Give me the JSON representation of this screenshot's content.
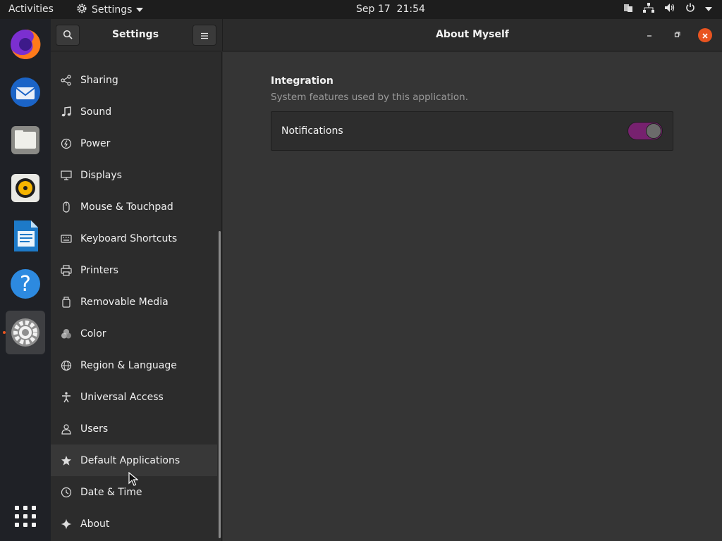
{
  "topbar": {
    "activities": "Activities",
    "app_menu": "Settings",
    "clock": "Sep 17  21:54"
  },
  "dock": {
    "items": [
      "firefox-icon",
      "thunderbird-icon",
      "files-icon",
      "rhythmbox-icon",
      "libreoffice-writer-icon",
      "help-icon",
      "settings-icon",
      "show-apps-icon"
    ]
  },
  "header": {
    "sidebar_title": "Settings",
    "page_title": "About Myself"
  },
  "sidebar": {
    "items": [
      {
        "label": "Sharing",
        "icon": "share-icon"
      },
      {
        "label": "Sound",
        "icon": "music-note-icon"
      },
      {
        "label": "Power",
        "icon": "power-icon"
      },
      {
        "label": "Displays",
        "icon": "display-icon"
      },
      {
        "label": "Mouse & Touchpad",
        "icon": "mouse-icon"
      },
      {
        "label": "Keyboard Shortcuts",
        "icon": "keyboard-icon"
      },
      {
        "label": "Printers",
        "icon": "printer-icon"
      },
      {
        "label": "Removable Media",
        "icon": "removable-media-icon"
      },
      {
        "label": "Color",
        "icon": "color-icon"
      },
      {
        "label": "Region & Language",
        "icon": "globe-icon"
      },
      {
        "label": "Universal Access",
        "icon": "accessibility-icon"
      },
      {
        "label": "Users",
        "icon": "users-icon"
      },
      {
        "label": "Default Applications",
        "icon": "star-icon"
      },
      {
        "label": "Date & Time",
        "icon": "clock-icon"
      },
      {
        "label": "About",
        "icon": "sparkle-icon"
      }
    ]
  },
  "content": {
    "section_title": "Integration",
    "section_subtitle": "System features used by this application.",
    "notifications_label": "Notifications",
    "notifications_enabled": true
  },
  "colors": {
    "accent": "#e95420",
    "switch_on": "#77216f",
    "dock_bg": "#1f2126",
    "topbar_bg": "#1d1d1d"
  }
}
